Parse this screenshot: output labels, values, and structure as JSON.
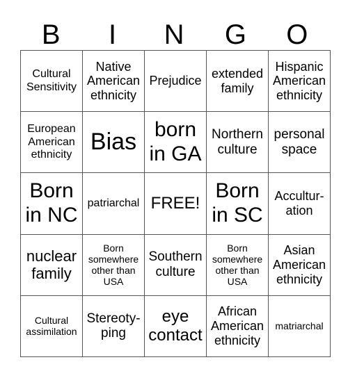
{
  "header": [
    "B",
    "I",
    "N",
    "G",
    "O"
  ],
  "cells": [
    [
      "Cultural Sensitivity",
      "Native American ethnicity",
      "Prejudice",
      "extended family",
      "Hispanic American ethnicity"
    ],
    [
      "European American ethnicity",
      "Bias",
      "born in GA",
      "Northern culture",
      "personal space"
    ],
    [
      "Born in NC",
      "patriarchal",
      "FREE!",
      "Born in SC",
      "Accultur-ation"
    ],
    [
      "nuclear family",
      "Born somewhere other than USA",
      "Southern culture",
      "Born somewhere other than USA",
      "Asian American ethnicity"
    ],
    [
      "Cultural assimilation",
      "Stereoty-ping",
      "eye contact",
      "African American ethnicity",
      "matriarchal"
    ]
  ]
}
